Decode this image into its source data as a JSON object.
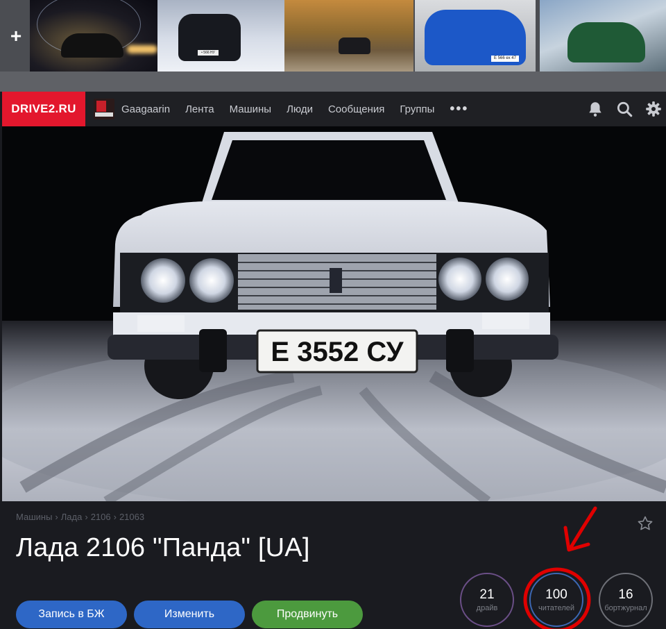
{
  "thumbnails": {
    "add_label": "+",
    "plate_1": "• 566 НУ",
    "plate_2": "Е 566 ех 47"
  },
  "header": {
    "logo": "DRIVE2.RU",
    "username": "Gaagaarin",
    "nav": [
      "Лента",
      "Машины",
      "Люди",
      "Сообщения",
      "Группы"
    ],
    "more": "•••"
  },
  "hero": {
    "plate": "Е 3552 СУ"
  },
  "car": {
    "breadcrumb": [
      "Машины",
      "Лада",
      "2106",
      "21063"
    ],
    "breadcrumb_sep": "›",
    "title": "Лада 2106 \"Панда\" [UA]"
  },
  "actions": {
    "logbook": "Запись в БЖ",
    "edit": "Изменить",
    "promote": "Продвинуть"
  },
  "stats": [
    {
      "value": "21",
      "label": "драйв"
    },
    {
      "value": "100",
      "label": "читателей"
    },
    {
      "value": "16",
      "label": "бортжурнал"
    }
  ],
  "colors": {
    "brand": "#e3172d",
    "button_blue": "#2e67c6",
    "button_green": "#4c9a3e",
    "annotation_red": "#e00000"
  },
  "icons": [
    "plus-icon",
    "bell-icon",
    "search-icon",
    "gear-icon",
    "star-icon",
    "annotation-arrow-icon"
  ]
}
